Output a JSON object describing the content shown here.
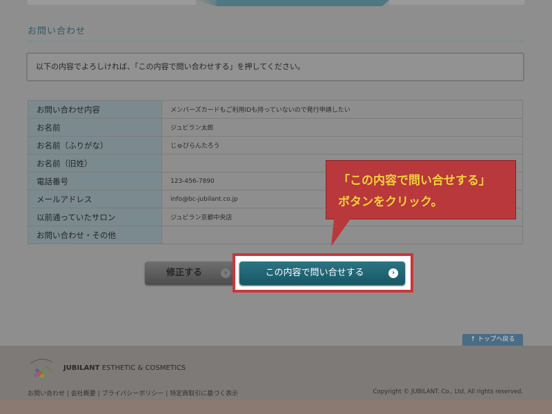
{
  "section": {
    "title": "お問い合わせ"
  },
  "notice": {
    "text": "以下の内容でよろしければ、「この内容で問い合わせする」を押してください。"
  },
  "form_rows": [
    {
      "label": "お問い合わせ内容",
      "value": "メンバーズカードもご利用IDも持っていないので発行申請したい"
    },
    {
      "label": "お名前",
      "value": "ジュビラン太郎"
    },
    {
      "label": "お名前（ふりがな）",
      "value": "じゅびらんたろう"
    },
    {
      "label": "お名前（旧姓）",
      "value": ""
    },
    {
      "label": "電話番号",
      "value": "123-456-7890"
    },
    {
      "label": "メールアドレス",
      "value": "info@bc-jubilant.co.jp"
    },
    {
      "label": "以前通っていたサロン",
      "value": "ジュビラン京都中央店"
    },
    {
      "label": "お問い合わせ・その他",
      "value": ""
    }
  ],
  "callout": {
    "line1": "「この内容で問い合せする」",
    "line2": "ボタンをクリック。"
  },
  "buttons": {
    "modify": "修正する",
    "submit": "この内容で問い合せする",
    "arrow": "›"
  },
  "back_to_top": "↑ トップへ戻る",
  "footer": {
    "brand_bold": "JUBILANT",
    "brand_rest": " ESTHETIC & COSMETICS",
    "links": [
      "お問い合わせ",
      "会社概要",
      "プライバシーポリシー",
      "特定商取引に基づく表示"
    ],
    "separator": " | ",
    "copyright": "Copyright © JUBILANT. Co., Ltd. All rights reserved."
  },
  "colors": {
    "accent": "#175766",
    "callout": "#b8383c",
    "callout_text": "#f3d23a"
  }
}
